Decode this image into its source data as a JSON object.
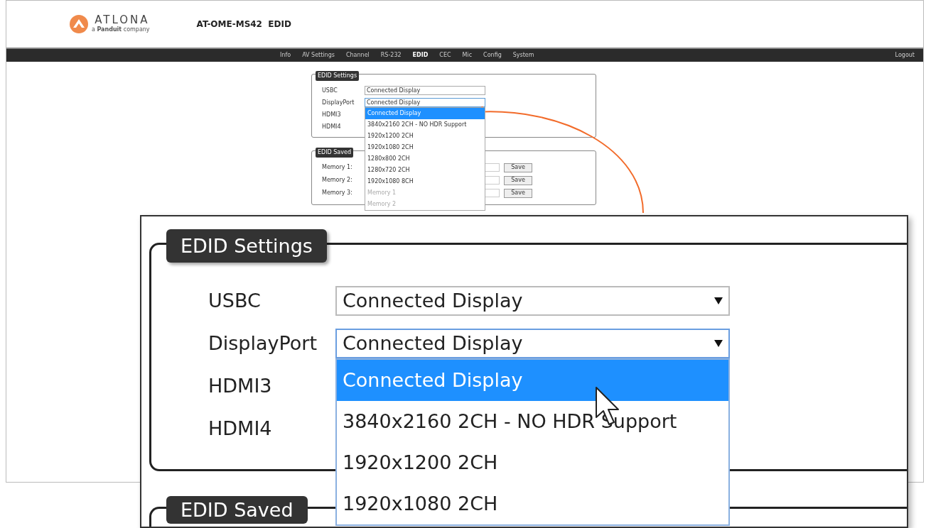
{
  "header": {
    "logo": "ATLONA",
    "logo_tagline": "a **Panduit** company",
    "title": "AT-OME-MS42  EDID"
  },
  "nav": {
    "items": [
      {
        "label": "Info",
        "selected": false
      },
      {
        "label": "AV Settings",
        "selected": false
      },
      {
        "label": "Channel",
        "selected": false
      },
      {
        "label": "RS-232",
        "selected": false
      },
      {
        "label": "EDID",
        "selected": true
      },
      {
        "label": "CEC",
        "selected": false
      },
      {
        "label": "Mic",
        "selected": false
      },
      {
        "label": "Config",
        "selected": false
      },
      {
        "label": "System",
        "selected": false
      }
    ],
    "logout": "Logout"
  },
  "page": {
    "edid_settings": {
      "legend": "EDID Settings",
      "rows": [
        {
          "label": "USBC",
          "value": "Connected Display",
          "open": false
        },
        {
          "label": "DisplayPort",
          "value": "Connected Display",
          "open": true
        },
        {
          "label": "HDMI3"
        },
        {
          "label": "HDMI4"
        }
      ]
    },
    "dropdown": [
      {
        "label": "Connected Display",
        "selected": true,
        "disabled": false
      },
      {
        "label": "3840x2160 2CH - NO HDR Support",
        "selected": false,
        "disabled": false
      },
      {
        "label": "1920x1200 2CH",
        "selected": false,
        "disabled": false
      },
      {
        "label": "1920x1080 2CH",
        "selected": false,
        "disabled": false
      },
      {
        "label": "1280x800 2CH",
        "selected": false,
        "disabled": false
      },
      {
        "label": "1280x720 2CH",
        "selected": false,
        "disabled": false
      },
      {
        "label": "1920x1080 8CH",
        "selected": false,
        "disabled": false
      },
      {
        "label": "Memory 1",
        "selected": false,
        "disabled": true
      },
      {
        "label": "Memory 2",
        "selected": false,
        "disabled": true
      }
    ],
    "edid_saved": {
      "legend": "EDID Saved",
      "rows": [
        {
          "label": "Memory 1:",
          "button": "Save"
        },
        {
          "label": "Memory 2:",
          "button": "Save"
        },
        {
          "label": "Memory 3:",
          "button": "Save"
        }
      ]
    }
  },
  "callout": {
    "legend": "EDID Settings",
    "rows": [
      {
        "label": "USBC",
        "value": "Connected Display",
        "open": false
      },
      {
        "label": "DisplayPort",
        "value": "Connected Display",
        "open": true
      },
      {
        "label": "HDMI3"
      },
      {
        "label": "HDMI4"
      }
    ],
    "dropdown": [
      {
        "label": "Connected Display",
        "selected": true
      },
      {
        "label": "3840x2160 2CH - NO HDR Support",
        "selected": false
      },
      {
        "label": "1920x1200 2CH",
        "selected": false
      },
      {
        "label": "1920x1080 2CH",
        "selected": false
      }
    ],
    "next_legend": "EDID Saved"
  }
}
